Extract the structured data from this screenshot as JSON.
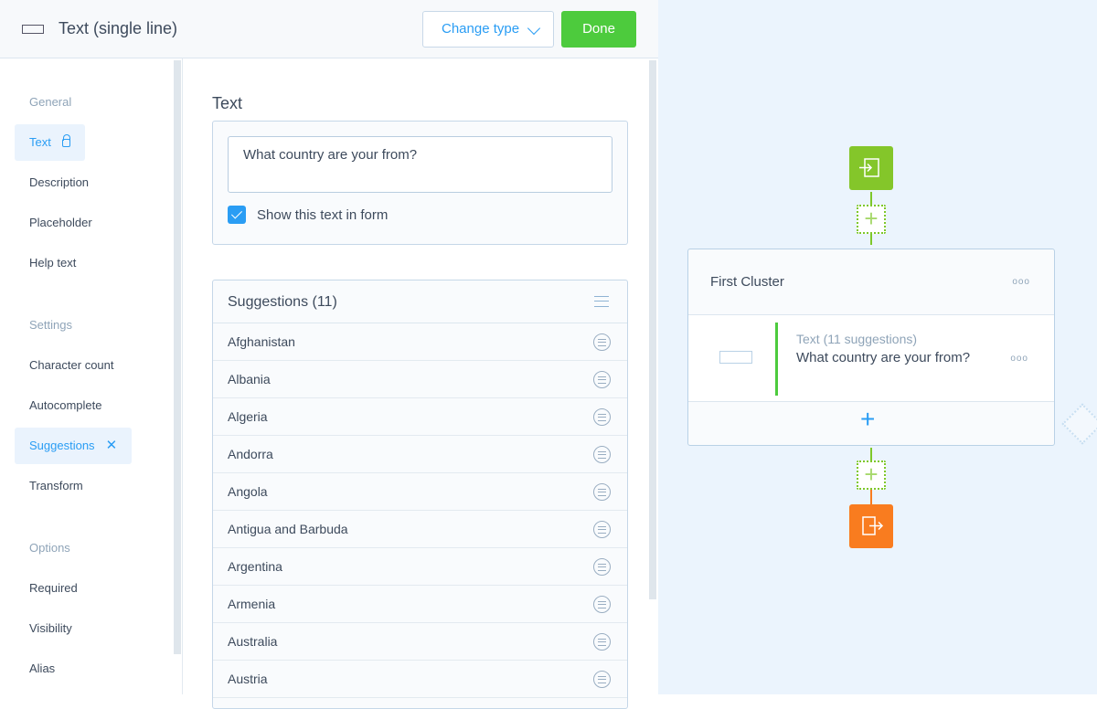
{
  "header": {
    "icon": "text-field-icon",
    "title": "Text (single line)",
    "change_type": "Change type",
    "done": "Done"
  },
  "sidebar": {
    "sections": [
      {
        "label": "General",
        "items": [
          {
            "label": "Text",
            "active": true,
            "icon": "lock-icon"
          },
          {
            "label": "Description"
          },
          {
            "label": "Placeholder"
          },
          {
            "label": "Help text"
          }
        ]
      },
      {
        "label": "Settings",
        "items": [
          {
            "label": "Character count"
          },
          {
            "label": "Autocomplete"
          },
          {
            "label": "Suggestions",
            "active": true,
            "icon": "close-icon"
          },
          {
            "label": "Transform"
          }
        ]
      },
      {
        "label": "Options",
        "items": [
          {
            "label": "Required"
          },
          {
            "label": "Visibility"
          },
          {
            "label": "Alias"
          }
        ]
      }
    ]
  },
  "main": {
    "text_label": "Text",
    "text_value": "What country are your from?",
    "show_checkbox": {
      "label": "Show this text in form",
      "checked": true
    },
    "suggestions": {
      "title": "Suggestions (11)",
      "items": [
        "Afghanistan",
        "Albania",
        "Algeria",
        "Andorra",
        "Angola",
        "Antigua and Barbuda",
        "Argentina",
        "Armenia",
        "Australia",
        "Austria"
      ]
    }
  },
  "canvas": {
    "cluster_title": "First Cluster",
    "field_subtitle": "Text (11 suggestions)",
    "field_question": "What country are your from?",
    "colors": {
      "start": "#84c62a",
      "end": "#f97c1f",
      "accent": "#2a9df4"
    }
  }
}
